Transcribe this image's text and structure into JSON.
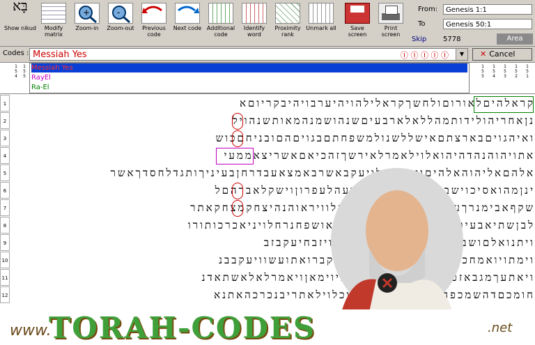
{
  "toolbar": {
    "buttons": [
      {
        "id": "show-nikud",
        "label": "Show nikud"
      },
      {
        "id": "modify-matrix",
        "label": "Modify matrix"
      },
      {
        "id": "zoom-in",
        "label": "Zoom-in"
      },
      {
        "id": "zoom-out",
        "label": "Zoom-out"
      },
      {
        "id": "previous-code",
        "label": "Previous code"
      },
      {
        "id": "next-code",
        "label": "Next code"
      },
      {
        "id": "additional-code",
        "label": "Additional code"
      },
      {
        "id": "identify-word",
        "label": "Identify word"
      },
      {
        "id": "proximity-rank",
        "label": "Proximity rank"
      },
      {
        "id": "unmark-all",
        "label": "Unmark all"
      },
      {
        "id": "save-screen",
        "label": "Save screen"
      },
      {
        "id": "print-screen",
        "label": "Print screen"
      }
    ]
  },
  "range": {
    "from_label": "From:",
    "from_value": "Genesis 1:1",
    "to_label": "To",
    "to_value": "Genesis 50:1"
  },
  "skip": {
    "label": "Skip",
    "value": "5778"
  },
  "area_label": "Area",
  "codes": {
    "label": "Codes :",
    "value": "Messiah Yes",
    "list": [
      "Messiah Yes",
      "RayEl",
      "Ra-El"
    ]
  },
  "cancel_label": "Cancel",
  "grid": {
    "row_numbers": [
      "1",
      "2",
      "3",
      "4",
      "5",
      "6",
      "7",
      "8",
      "9",
      "10",
      "11",
      "12"
    ],
    "rows": [
      "קראלהיםלאורוםולחשךקראלילהויהיערבויהיבקריוםא",
      "נןאחריהולידותמהללאלארבעיםשנהושמנהמאותשנהויל",
      "ואיהגויםבארצתםאישללשנולמשפחתםבגויםהםובניחםכוש",
      "אתויהוהנהדהיהואלוילאמרלאירשךזהכיאםאשריצאממעי",
      "אלהםאליהוהאלהיםויאמראלויעקבאשרבאמצאעבדרחןבעיניךותגדלחסדךאשר",
      "ינןמהואסיכוישבעעקברןוישמעאבעהלעפרוןוישקלאברהםל",
      "שקףאבימנרךעשוהברכהזביאעבדהחלוויראוהנהיצחקמצחקאתר",
      "לבןשתיאבעיונונתנואתהוהבדהטקאלאושפחנרחלויניאכרכותורו",
      "ויתנואלםושבעיעקבבפםחדאבויצחקוויזבחיעקבזב",
      "וימתויואמחכםיבעששישיםשבועיםויקברואתועשוויעקבבנ",
      "ויאתעךמגבאזטוויאמראלמשכהבעמיוימאןויאמרלאלאשתאדנ",
      "חומכםדהשמכפהיכוואלואתםאסרוכלוילאתריבנכרכהאתנא"
    ]
  },
  "banner": {
    "prefix": "www.",
    "main": "TORAH-CODES",
    "suffix": ".net"
  },
  "colors": {
    "accent": "#0a3fd6",
    "highlight": "#cc0000",
    "found": "#008000",
    "toolbar_bg": "#d4d0c8"
  }
}
